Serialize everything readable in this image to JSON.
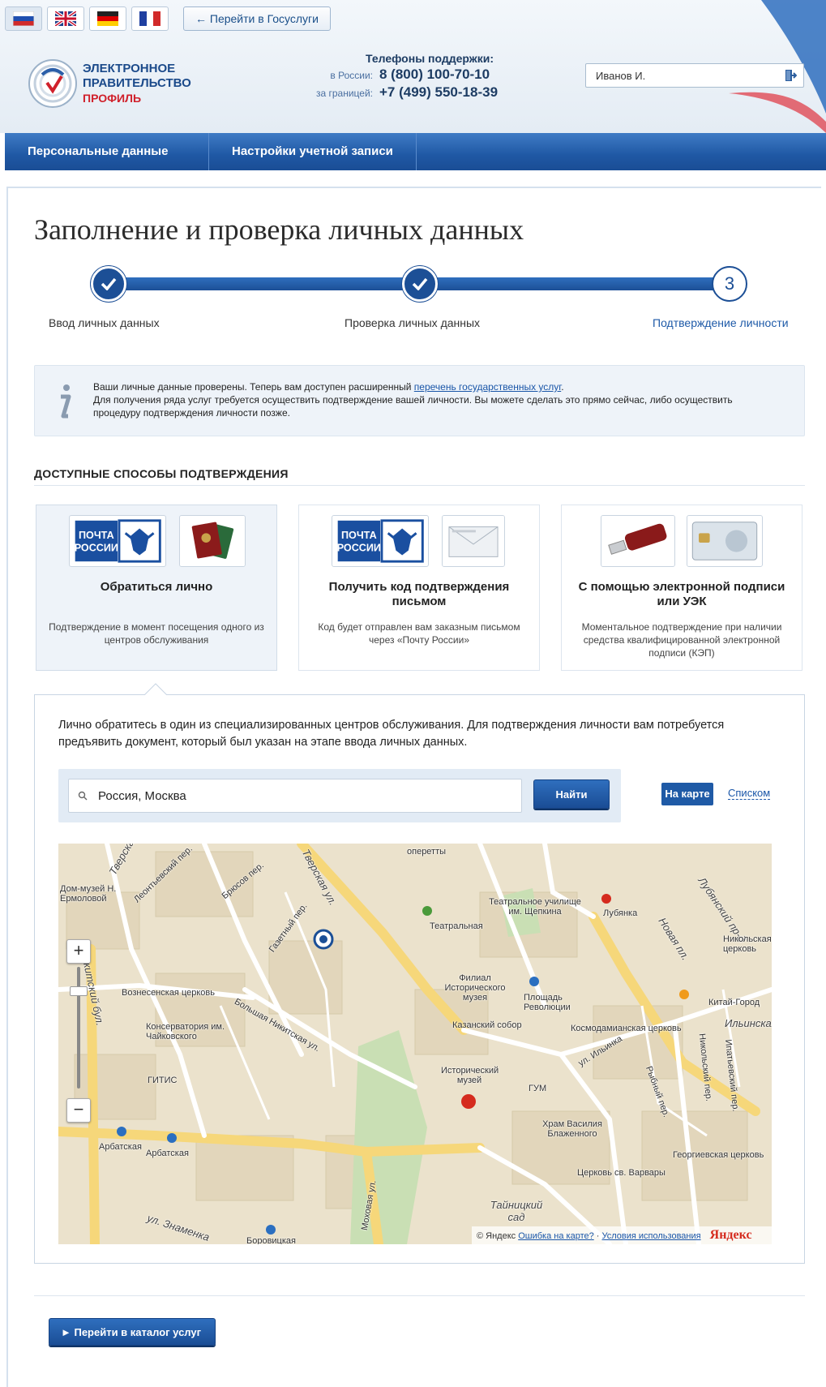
{
  "header": {
    "languages": [
      {
        "code": "ru",
        "icon": "flag-russia-icon"
      },
      {
        "code": "en",
        "icon": "flag-uk-icon"
      },
      {
        "code": "de",
        "icon": "flag-germany-icon"
      },
      {
        "code": "fr",
        "icon": "flag-france-icon"
      }
    ],
    "gosuslugi_link": "← Перейти в Госуслуги",
    "logo": {
      "line1": "ЭЛЕКТРОННОЕ",
      "line2": "ПРАВИТЕЛЬСТВО",
      "line3": "ПРОФИЛЬ"
    },
    "support": {
      "title": "Телефоны поддержки:",
      "russia_label": "в России:",
      "russia_phone": "8 (800) 100-70-10",
      "abroad_label": "за границей:",
      "abroad_phone": "+7 (499) 550-18-39"
    },
    "user_name": "Иванов И."
  },
  "nav": {
    "items": [
      {
        "label": "Персональные данные"
      },
      {
        "label": "Настройки учетной записи"
      }
    ]
  },
  "page": {
    "title": "Заполнение и проверка личных данных"
  },
  "stepper": {
    "steps": [
      {
        "label": "Ввод личных данных",
        "state": "done"
      },
      {
        "label": "Проверка личных данных",
        "state": "done"
      },
      {
        "label": "Подтверждение личности",
        "state": "current",
        "number": "3"
      }
    ]
  },
  "info": {
    "line1_prefix": "Ваши личные данные проверены. Теперь вам доступен расширенный ",
    "line1_link": "перечень государственных услуг",
    "line1_suffix": ".",
    "line2": "Для получения ряда услуг требуется осуществить подтверждение вашей личности. Вы можете сделать это прямо сейчас, либо осуществить процедуру подтверждения личности позже."
  },
  "section": {
    "title": "ДОСТУПНЫЕ СПОСОБЫ ПОДТВЕРЖДЕНИЯ"
  },
  "methods": [
    {
      "title": "Обратиться лично",
      "desc": "Подтверждение в момент посещения одного из центров обслуживания",
      "active": true
    },
    {
      "title": "Получить код подтверждения письмом",
      "desc": "Код будет отправлен вам заказным письмом через «Почту России»",
      "active": false
    },
    {
      "title": "С помощью электронной подписи или УЭК",
      "desc": "Моментальное подтверждение при наличии средства квалифицированной электронной подписи (КЭП)",
      "active": false
    }
  ],
  "pochta_logo": {
    "line1": "ПОЧТА",
    "line2": "РОССИИ"
  },
  "panel": {
    "text": "Лично обратитесь в один из специализированных центров обслуживания. Для подтверждения личности вам потребуется предъявить документ, который был указан на этапе ввода личных данных.",
    "search_value": "Россия, Москва",
    "find_label": "Найти",
    "tab_map": "На карте",
    "tab_list": "Списком"
  },
  "map": {
    "streets": [
      {
        "text": "Тверская ул.",
        "big": true
      },
      {
        "text": "Тверская",
        "big": true
      },
      {
        "text": "Новая пл.",
        "big": true
      },
      {
        "text": "Лубянский пр-д",
        "big": true
      },
      {
        "text": "ул. Знаменка",
        "big": true
      },
      {
        "text": "ул. Ильинка",
        "big": false
      },
      {
        "text": "Никитский бул.",
        "big": true
      },
      {
        "text": "Брюсов пер.",
        "big": false
      },
      {
        "text": "Леонтьевский пер.",
        "big": false
      },
      {
        "text": "Газетный пер.",
        "big": false
      },
      {
        "text": "Большая Никитская ул.",
        "big": false
      },
      {
        "text": "Рыбный пер.",
        "big": false
      },
      {
        "text": "Никольский пер.",
        "big": false
      },
      {
        "text": "Ипатьевский пер.",
        "big": false
      },
      {
        "text": "Моховая ул.",
        "big": false
      }
    ],
    "places": [
      {
        "text": "Театральная"
      },
      {
        "text": "Лубянка"
      },
      {
        "text": "Площадь Революции"
      },
      {
        "text": "Китай-Город"
      },
      {
        "text": "Арбатская"
      },
      {
        "text": "Арбатская"
      },
      {
        "text": "Боровицкая"
      },
      {
        "text": "Дом-музей Н. Ермоловой"
      },
      {
        "text": "Вознесенская церковь"
      },
      {
        "text": "Консерватория им. Чайковского"
      },
      {
        "text": "ГИТИС"
      },
      {
        "text": "Театральное училище им. Щепкина"
      },
      {
        "text": "Филиал Исторического музея"
      },
      {
        "text": "Казанский собор"
      },
      {
        "text": "Исторический музей"
      },
      {
        "text": "ГУМ"
      },
      {
        "text": "Космодамианская церковь"
      },
      {
        "text": "Храм Василия Блаженного"
      },
      {
        "text": "Церковь св. Варвары"
      },
      {
        "text": "Георгиевская церковь"
      },
      {
        "text": "Тайницкий сад"
      },
      {
        "text": "Никольская церковь"
      },
      {
        "text": "Ильинская"
      },
      {
        "text": "оперетты"
      }
    ],
    "footer_copyright": "© Яндекс",
    "footer_error_link": "Ошибка на карте?",
    "footer_terms_link": "Условия использования",
    "footer_logo": "Яндекс"
  },
  "catalog_button": "► Перейти в каталог услуг",
  "colors": {
    "brand_blue": "#1f58a4",
    "accent_red": "#d0202b",
    "link": "#1a56a8"
  }
}
